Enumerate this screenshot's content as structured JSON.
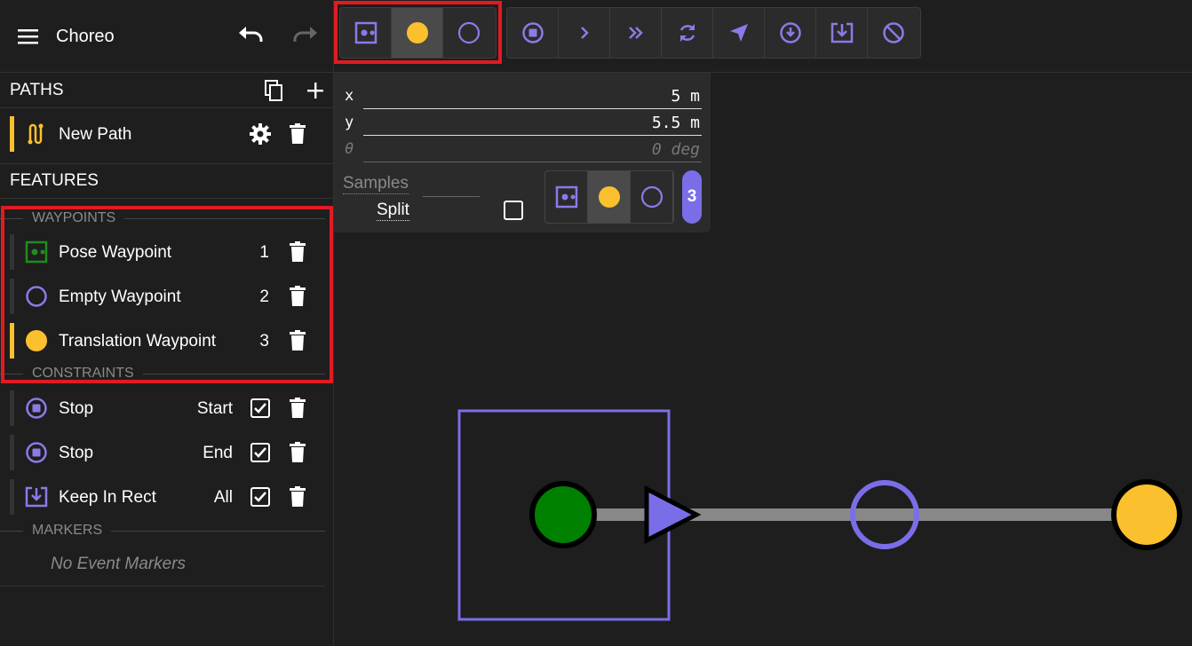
{
  "app": {
    "title": "Choreo"
  },
  "paths": {
    "heading": "PATHS",
    "items": [
      {
        "label": "New Path"
      }
    ]
  },
  "features": {
    "heading": "FEATURES",
    "waypoints_heading": "WAYPOINTS",
    "waypoints": [
      {
        "label": "Pose Waypoint",
        "index": "1",
        "icon": "pose-waypoint-icon",
        "color": "#1e8c1e"
      },
      {
        "label": "Empty Waypoint",
        "index": "2",
        "icon": "empty-waypoint-icon",
        "color": "#8a7be8"
      },
      {
        "label": "Translation Waypoint",
        "index": "3",
        "icon": "translation-waypoint-icon",
        "color": "#fbc02d"
      }
    ],
    "constraints_heading": "CONSTRAINTS",
    "constraints": [
      {
        "label": "Stop",
        "scope": "Start",
        "icon": "stop-icon",
        "checked": true
      },
      {
        "label": "Stop",
        "scope": "End",
        "icon": "stop-icon",
        "checked": true
      },
      {
        "label": "Keep In Rect",
        "scope": "All",
        "icon": "keep-in-rect-icon",
        "checked": true
      }
    ],
    "markers_heading": "MARKERS",
    "markers_empty": "No Event Markers"
  },
  "properties": {
    "x_label": "x",
    "x_value": "5 m",
    "y_label": "y",
    "y_value": "5.5 m",
    "theta_label": "θ",
    "theta_value": "0 deg",
    "samples_label": "Samples",
    "split_label": "Split",
    "split_checked": false,
    "selected_index": "3"
  },
  "colors": {
    "accent": "#7a6ee8",
    "translation": "#fbc02d",
    "pose": "#1e8c1e",
    "highlight": "#e01b22"
  }
}
